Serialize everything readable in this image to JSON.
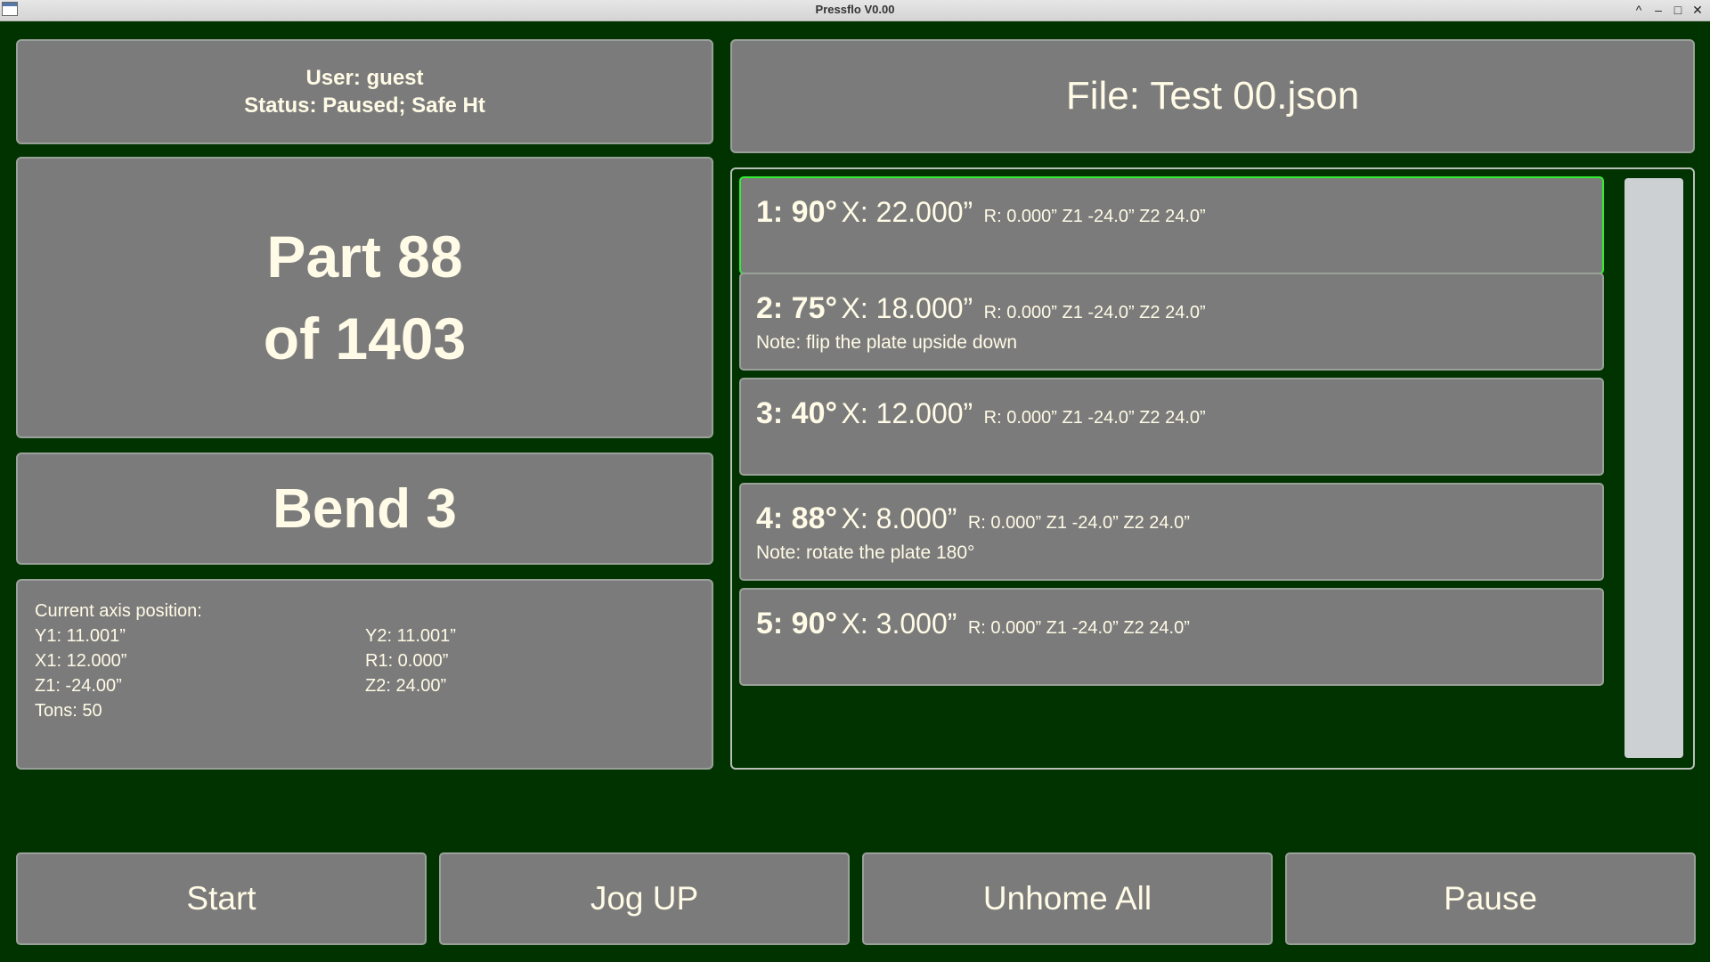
{
  "window": {
    "title": "Pressflo V0.00",
    "controls": [
      "^",
      "–",
      "□",
      "✕"
    ]
  },
  "status": {
    "user": "User: guest",
    "status": "Status: Paused; Safe Ht"
  },
  "file": {
    "label": "File: Test 00.json"
  },
  "part": {
    "line1": "Part 88",
    "line2": "of 1403"
  },
  "bend": {
    "label": "Bend 3"
  },
  "axis": {
    "heading": "Current axis position:",
    "y1": "Y1: 11.001”",
    "y2": "Y2: 11.001”",
    "x1": "X1: 12.000”",
    "r1": "R1: 0.000”",
    "z1": "Z1: -24.00”",
    "z2": "Z2: 24.00”",
    "tons": "Tons: 50"
  },
  "bends": [
    {
      "angle": "1: 90°",
      "x": "X: 22.000”",
      "rest": "R: 0.000”  Z1 -24.0”  Z2 24.0”",
      "note": "",
      "selected": true
    },
    {
      "angle": "2: 75°",
      "x": "X: 18.000”",
      "rest": "R: 0.000”  Z1 -24.0”  Z2 24.0”",
      "note": "Note: flip the plate upside down",
      "selected": false
    },
    {
      "angle": "3: 40°",
      "x": "X: 12.000”",
      "rest": "R: 0.000”  Z1 -24.0”  Z2 24.0”",
      "note": "",
      "selected": false
    },
    {
      "angle": "4: 88°",
      "x": "X: 8.000”",
      "rest": "R: 0.000”  Z1 -24.0”  Z2 24.0”",
      "note": "Note: rotate the plate 180°",
      "selected": false
    },
    {
      "angle": "5: 90°",
      "x": "X: 3.000”",
      "rest": "R: 0.000”  Z1 -24.0”  Z2 24.0”",
      "note": "",
      "selected": false
    }
  ],
  "buttons": {
    "start": "Start",
    "jog_up": "Jog UP",
    "unhome_all": "Unhome All",
    "pause": "Pause"
  },
  "colors": {
    "background": "#003300",
    "panel": "#7b7b7b",
    "selected_border": "#33ee33",
    "text": "#fffbe6"
  }
}
